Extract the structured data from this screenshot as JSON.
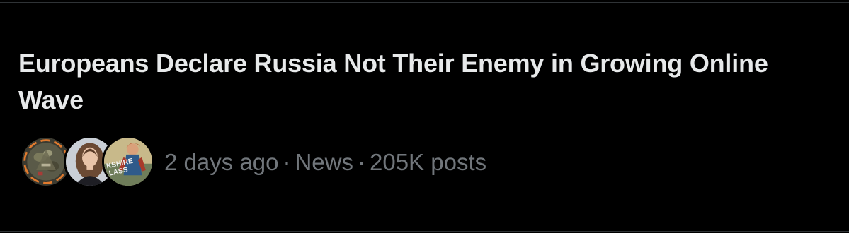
{
  "trend": {
    "headline": "Europeans Declare Russia Not Their Enemy in Growing Online Wave",
    "time_ago": "2 days ago",
    "category": "News",
    "post_count": "205K posts",
    "separator": "·"
  },
  "avatars": [
    {
      "icon": "camouflage-soldier-avatar"
    },
    {
      "icon": "woman-portrait-avatar"
    },
    {
      "icon": "comic-art-avatar",
      "text": "KSHIRE LASS"
    }
  ],
  "colors": {
    "background": "#000000",
    "headline": "#e7e9ea",
    "meta": "#71767b",
    "divider": "#2f3336",
    "avatar_ring": "#e07a2e"
  }
}
